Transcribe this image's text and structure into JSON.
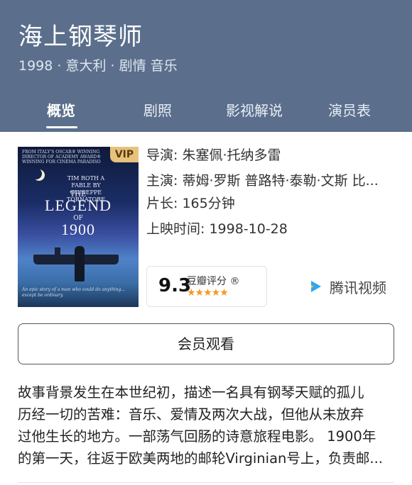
{
  "header": {
    "title": "海上钢琴师",
    "meta": "1998 · 意大利 · 剧情 音乐",
    "tabs": [
      {
        "label": "概览",
        "active": true
      },
      {
        "label": "剧照",
        "active": false
      },
      {
        "label": "影视解说",
        "active": false
      },
      {
        "label": "演员表",
        "active": false
      }
    ],
    "bg_color": "#5b6f8c"
  },
  "poster": {
    "credits": "FROM ITALY'S OSCAR® WINNING DIRECTOR OF ACADEMY AWARD® WINNING FOR CINEMA PARADISO",
    "sub": "TIM ROTH  A FABLE BY GIUSEPPE TORNATORE",
    "the": "THE",
    "legend": "LEGEND",
    "of": "OF",
    "year": "1900",
    "tagline": "An epic story of a man who could do anything... except be ordinary.",
    "vip_badge": "VIP"
  },
  "info": {
    "director": "导演: 朱塞佩·托纳多雷",
    "cast": "主演: 蒂姆·罗斯 普路特·泰勒·文斯 比...",
    "runtime": "片长: 165分钟",
    "release": "上映时间: 1998-10-28"
  },
  "rating": {
    "score": "9.3",
    "label": "豆瓣评分 ®",
    "stars_text": "★★★★★",
    "stars_value": 4.5
  },
  "platform": {
    "icon": "tencent-video-play-icon",
    "label": "腾讯视频"
  },
  "watch_button": "会员观看",
  "description": [
    "故事背景发生在本世纪初，描述一名具有钢琴天赋的孤儿",
    "历经一切的苦难：音乐、爱情及两次大战，但他从未放弃",
    "过他生长的地方。一部荡气回肠的诗意旅程电影。 1900年",
    "的第一天，往返于欧美两地的邮轮Virginian号上，负责邮..."
  ]
}
